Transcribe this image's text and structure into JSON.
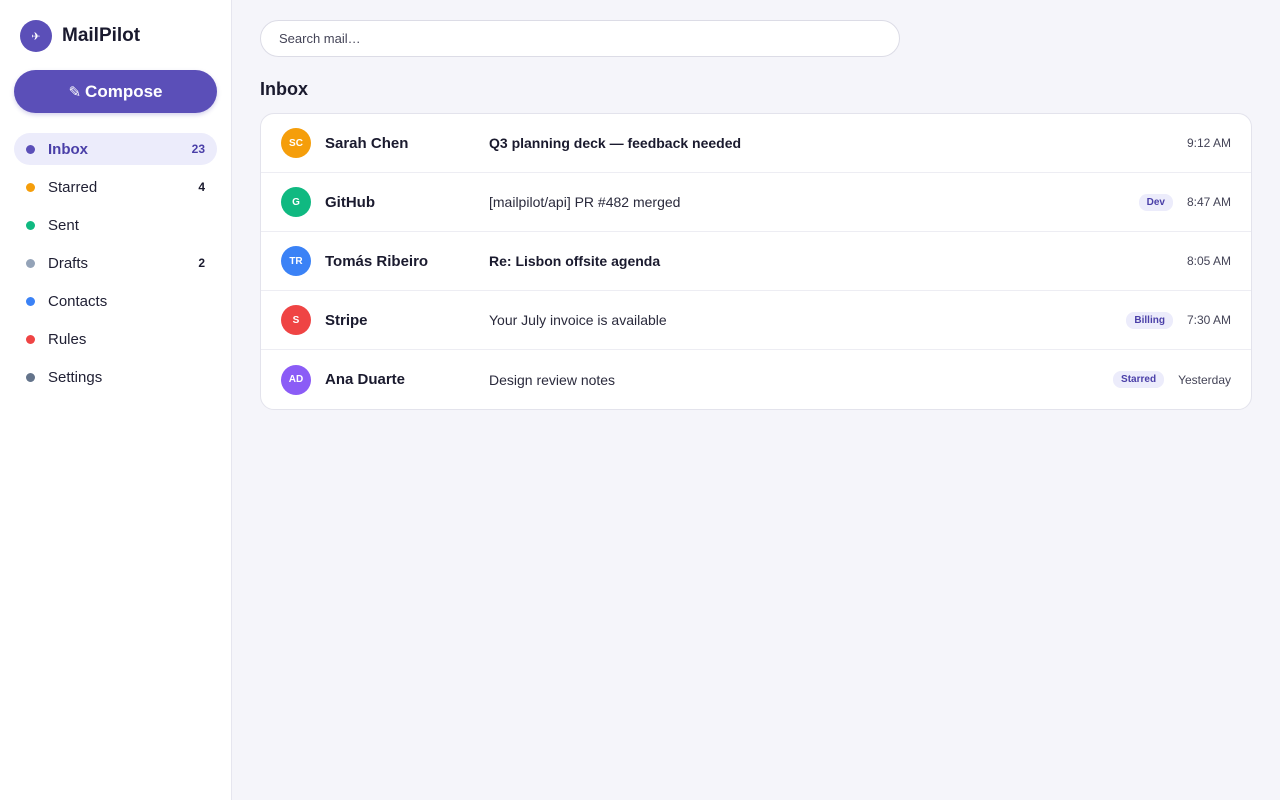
{
  "app": {
    "name": "MailPilot",
    "logo_icon": "paper-plane-icon",
    "accent": "#5b4fb8"
  },
  "compose": {
    "label": "Compose",
    "icon": "pencil-icon"
  },
  "sidebar": {
    "items": [
      {
        "label": "Inbox",
        "count": "23",
        "color": "#5b4fb8",
        "active": true
      },
      {
        "label": "Starred",
        "count": "4",
        "color": "#f59e0b",
        "active": false
      },
      {
        "label": "Sent",
        "count": "",
        "color": "#10b981",
        "active": false
      },
      {
        "label": "Drafts",
        "count": "2",
        "color": "#94a3b8",
        "active": false
      },
      {
        "label": "Contacts",
        "count": "",
        "color": "#3b82f6",
        "active": false
      },
      {
        "label": "Rules",
        "count": "",
        "color": "#ef4444",
        "active": false
      },
      {
        "label": "Settings",
        "count": "",
        "color": "#64748b",
        "active": false
      }
    ]
  },
  "search": {
    "placeholder": "Search mail…",
    "value": ""
  },
  "main": {
    "title": "Inbox"
  },
  "messages": [
    {
      "initials": "SC",
      "avatar_color": "#f59e0b",
      "sender": "Sarah Chen",
      "subject": "Q3 planning deck — feedback needed",
      "unread": true,
      "label": "",
      "time": "9:12 AM"
    },
    {
      "initials": "G",
      "avatar_color": "#10b981",
      "sender": "GitHub",
      "subject": "[mailpilot/api] PR #482 merged",
      "unread": false,
      "label": "Dev",
      "time": "8:47 AM"
    },
    {
      "initials": "TR",
      "avatar_color": "#3b82f6",
      "sender": "Tomás Ribeiro",
      "subject": "Re: Lisbon offsite agenda",
      "unread": true,
      "label": "",
      "time": "8:05 AM"
    },
    {
      "initials": "S",
      "avatar_color": "#ef4444",
      "sender": "Stripe",
      "subject": "Your July invoice is available",
      "unread": false,
      "label": "Billing",
      "time": "7:30 AM"
    },
    {
      "initials": "AD",
      "avatar_color": "#8b5cf6",
      "sender": "Ana Duarte",
      "subject": "Design review notes",
      "unread": false,
      "label": "Starred",
      "time": "Yesterday"
    }
  ]
}
